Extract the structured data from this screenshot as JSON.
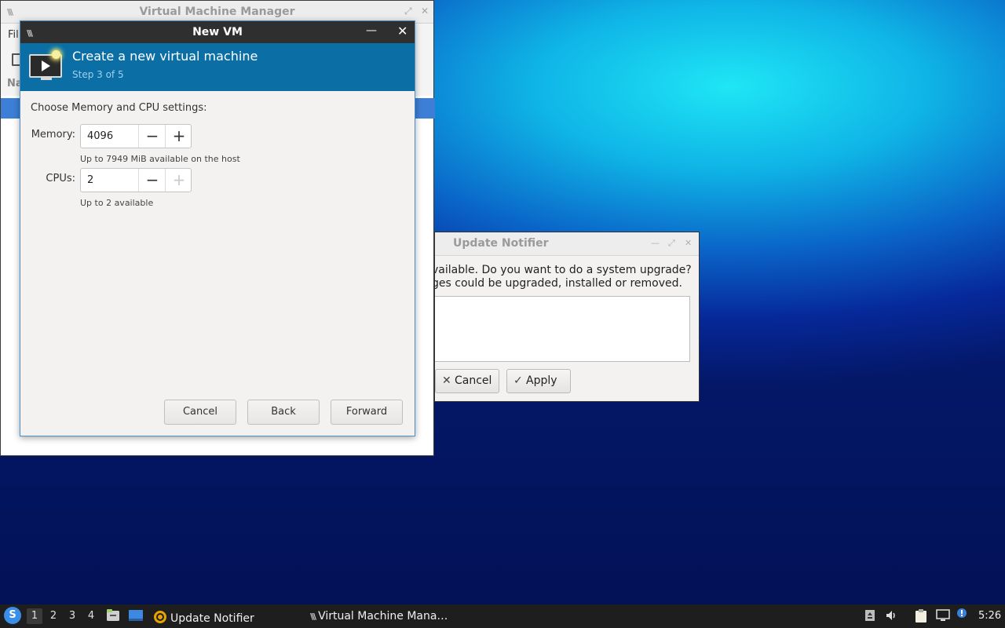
{
  "vmm": {
    "title": "Virtual Machine Manager",
    "menu_file": "Fil",
    "column_name": "Na"
  },
  "newvm": {
    "title": "New VM",
    "banner_title": "Create a new virtual machine",
    "banner_step": "Step 3 of 5",
    "section_label": "Choose Memory and CPU settings:",
    "memory_label": "Memory:",
    "memory_value": "4096",
    "memory_hint": "Up to 7949 MiB available on the host",
    "cpus_label": "CPUs:",
    "cpus_value": "2",
    "cpus_hint": "Up to 2 available",
    "cancel_label": "Cancel",
    "back_label": "Back",
    "forward_label": "Forward"
  },
  "notifier": {
    "title": "Update Notifier",
    "line1": "vailable. Do you want to do a system upgrade?",
    "line2": "ges could be upgraded, installed or removed.",
    "cancel_label": "Cancel",
    "apply_label": "Apply"
  },
  "taskbar": {
    "workspaces": [
      "1",
      "2",
      "3",
      "4"
    ],
    "active_workspace": "1",
    "task_update_notifier": "Update Notifier",
    "task_vmm": "Virtual Machine Mana…",
    "clock": "5:26"
  },
  "icons": {
    "start": "lxqt-start-icon",
    "file_manager": "file-manager-icon",
    "show_desktop": "show-desktop-icon",
    "updater": "update-notifier-icon",
    "vmm": "virt-manager-icon",
    "tray": [
      "removable-drive-icon",
      "volume-icon",
      "clipboard-icon",
      "network-icon",
      "notification-icon"
    ]
  },
  "colors": {
    "banner": "#0b6fa5",
    "selection": "#3d7fd6",
    "taskbar": "#1e1e1e"
  }
}
